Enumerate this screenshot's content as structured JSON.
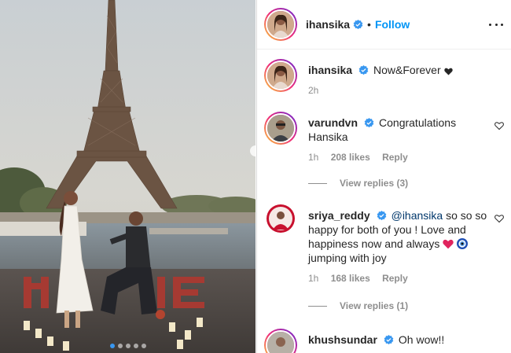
{
  "post": {
    "carousel": {
      "count": 5,
      "active_index": 0
    }
  },
  "header": {
    "username": "ihansika",
    "separator": "•",
    "follow_label": "Follow"
  },
  "caption": {
    "username": "ihansika",
    "text": "Now&Forever",
    "time": "2h"
  },
  "comments": [
    {
      "username": "varundvn",
      "text": "Congratulations Hansika",
      "time": "1h",
      "likes": "208 likes",
      "reply_label": "Reply",
      "view_replies": "View replies (3)"
    },
    {
      "username": "sriya_reddy",
      "mention": "@ihansika",
      "text": " so so so happy for both of you ! Love and happiness now and always",
      "text_after": " jumping with joy",
      "time": "1h",
      "likes": "168 likes",
      "reply_label": "Reply",
      "view_replies": "View replies (1)"
    },
    {
      "username": "khushsundar",
      "text": "Oh wow!!"
    }
  ],
  "colors": {
    "link": "#0095f6",
    "verified": "#3897f0",
    "muted": "#8e8e8e"
  },
  "icons": [
    "verified-badge-icon",
    "more-options-icon",
    "heart-icon",
    "red-heart-emoji",
    "nazar-amulet-emoji"
  ]
}
